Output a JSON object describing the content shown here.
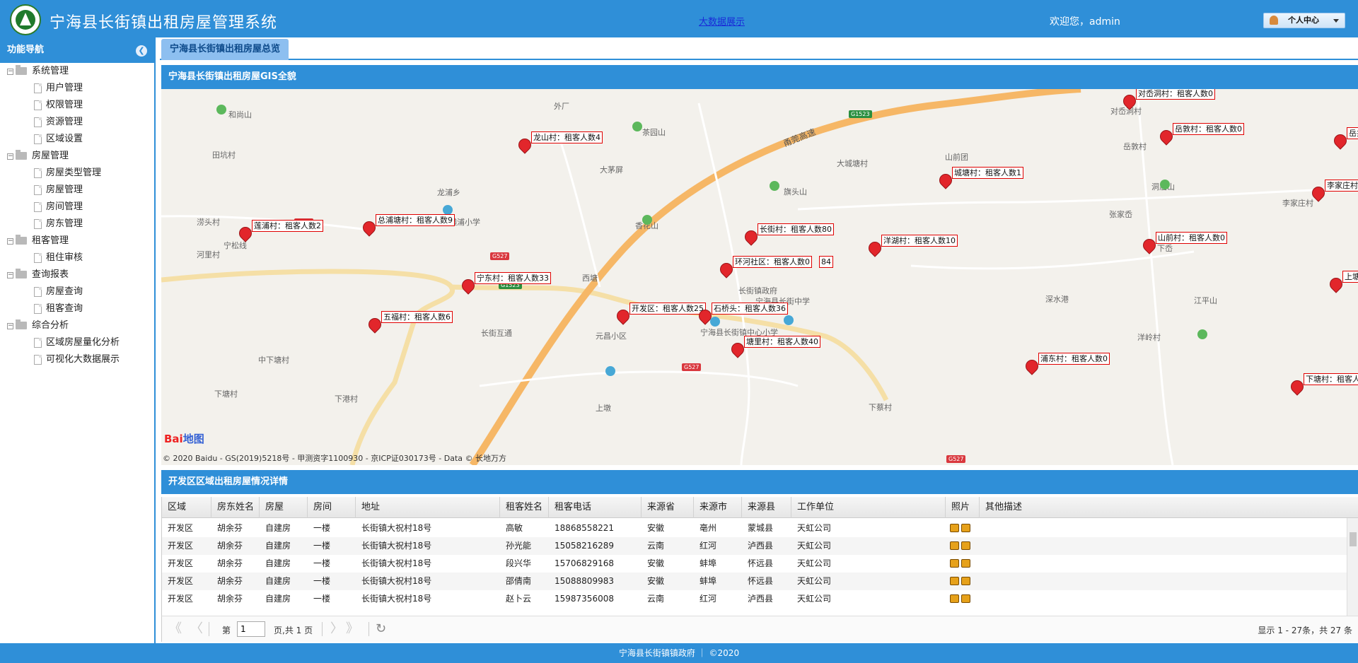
{
  "header": {
    "title": "宁海县长街镇出租房屋管理系统",
    "bigdata_link": "大数据展示",
    "welcome": "欢迎您，admin",
    "personal_center": "个人中心"
  },
  "sidebar": {
    "title": "功能导航",
    "groups": [
      {
        "label": "系统管理",
        "items": [
          "用户管理",
          "权限管理",
          "资源管理",
          "区域设置"
        ]
      },
      {
        "label": "房屋管理",
        "items": [
          "房屋类型管理",
          "房屋管理",
          "房间管理",
          "房东管理"
        ]
      },
      {
        "label": "租客管理",
        "items": [
          "租住审核"
        ]
      },
      {
        "label": "查询报表",
        "items": [
          "房屋查询",
          "租客查询"
        ]
      },
      {
        "label": "综合分析",
        "items": [
          "区域房屋量化分析",
          "可视化大数据展示"
        ]
      }
    ]
  },
  "tabs": {
    "overview": "宁海县长街镇出租房屋总览"
  },
  "map_panel": {
    "title": "宁海县长街镇出租房屋GIS全貌",
    "copyright": "© 2020 Baidu - GS(2019)5218号 - 甲测资字1100930 - 京ICP证030173号 - Data © 长地万方",
    "baidu_logo_a": "Bai",
    "baidu_logo_b": "地图",
    "places": [
      "外厂",
      "和尚山",
      "茶园山",
      "大茅屏",
      "田坑村",
      "龙浦乡",
      "旗头山",
      "香花山",
      "涝头村",
      "宁松线",
      "河里村",
      "西塘",
      "长街镇政府",
      "宁海县长街镇中心小学",
      "宁海县长街中学",
      "长街互通",
      "元昌小区",
      "中下塘村",
      "下塘村",
      "下港村",
      "上墩",
      "大城塘村",
      "山前团",
      "洞庙山",
      "张家岙",
      "下岙",
      "深水港",
      "江平山",
      "下蔡村",
      "洋岭村",
      "对岙洞村",
      "岳敦村",
      "李家庄村",
      "甬莞高速",
      "横浦小学"
    ],
    "markers": [
      "龙山村：租客人数4",
      "对岙洞村：租客人数0",
      "岳敦村：租客人数0",
      "岳井村：租客人数",
      "城塘村：租客人数1",
      "李家庄村：租客",
      "莲浦村：租客人数2",
      "总浦塘村：租客人数9",
      "长街村：租客人数80",
      "洋湖村：租客人数10",
      "山前村：租客人数0",
      "环河社区：租客人数0",
      "上塘村",
      "宁东村：租客人数33",
      "开发区：租客人数25",
      "石桥头：租客人数36",
      "五福村：租客人数6",
      "塘里村：租客人数40",
      "浦东村：租客人数0",
      "下塘村：租客人"
    ],
    "marker_suffix_84": "84",
    "road_tags": [
      "G1523",
      "G527",
      "G527",
      "G1523",
      "G527",
      "G527"
    ]
  },
  "grid_panel": {
    "title": "开发区区域出租房屋情况详情",
    "columns": [
      "区域",
      "房东姓名",
      "房屋",
      "房间",
      "地址",
      "租客姓名",
      "租客电话",
      "来源省",
      "来源市",
      "来源县",
      "工作单位",
      "照片",
      "其他描述"
    ],
    "rows": [
      [
        "开发区",
        "胡余芬",
        "自建房",
        "一楼",
        "长街镇大祝村18号",
        "高敏",
        "18868558221",
        "安徽",
        "亳州",
        "蒙城县",
        "天虹公司"
      ],
      [
        "开发区",
        "胡余芬",
        "自建房",
        "一楼",
        "长街镇大祝村18号",
        "孙光能",
        "15058216289",
        "云南",
        "红河",
        "泸西县",
        "天虹公司"
      ],
      [
        "开发区",
        "胡余芬",
        "自建房",
        "一楼",
        "长街镇大祝村18号",
        "段兴华",
        "15706829168",
        "安徽",
        "蚌埠",
        "怀远县",
        "天虹公司"
      ],
      [
        "开发区",
        "胡余芬",
        "自建房",
        "一楼",
        "长街镇大祝村18号",
        "邵倩南",
        "15088809983",
        "安徽",
        "蚌埠",
        "怀远县",
        "天虹公司"
      ],
      [
        "开发区",
        "胡余芬",
        "自建房",
        "一楼",
        "长街镇大祝村18号",
        "赵卜云",
        "15987356008",
        "云南",
        "红河",
        "泸西县",
        "天虹公司"
      ]
    ]
  },
  "pager": {
    "page_label": "第",
    "page_value": "1",
    "page_total": "页,共 1 页",
    "info": "显示 1 - 27条，共 27 条"
  },
  "footer": {
    "text": "宁海县长街镇镇政府 ｜ ©2020"
  },
  "colors": {
    "primary": "#2f8fd8",
    "marker": "#e2262b",
    "highway": "#f7b867"
  }
}
